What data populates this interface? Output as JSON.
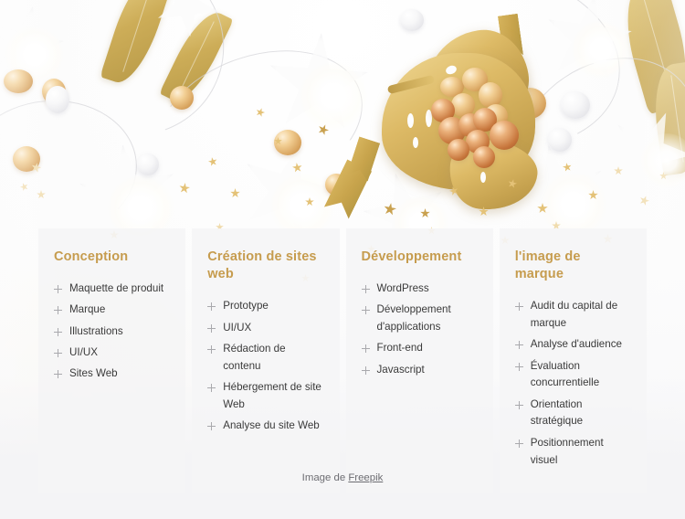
{
  "hero": {
    "alt": "festive gold flat lay with monstera leaf tray, ornaments and star lights"
  },
  "services": {
    "columns": [
      {
        "id": "conception",
        "title": "Conception",
        "items": [
          "Maquette de produit",
          "Marque",
          "Illustrations",
          "UI/UX",
          "Sites Web"
        ]
      },
      {
        "id": "creation-de-sites-web",
        "title": "Création de sites web",
        "items": [
          "Prototype",
          "UI/UX",
          "Rédaction de contenu",
          "Hébergement de site Web",
          "Analyse du site Web"
        ]
      },
      {
        "id": "developpement",
        "title": "Développement",
        "items": [
          "WordPress",
          "Développement d'applications",
          "Front-end",
          "Javascript"
        ]
      },
      {
        "id": "image-de-marque",
        "title": "l'image de marque",
        "items": [
          "Audit du capital de marque",
          "Analyse d'audience",
          "Évaluation concurrentielle",
          "Orientation stratégique",
          "Positionnement visuel"
        ]
      }
    ]
  },
  "credit": {
    "prefix": "Image de ",
    "link_label": "Freepik"
  },
  "colors": {
    "heading_gold": "#c69c4e",
    "body_text": "#3a3a3a",
    "plus_icon": "#a9a9ad",
    "card_bg": "#f5f5f6",
    "page_bg": "#f4f4f6",
    "credit_text": "#6d6d72"
  }
}
